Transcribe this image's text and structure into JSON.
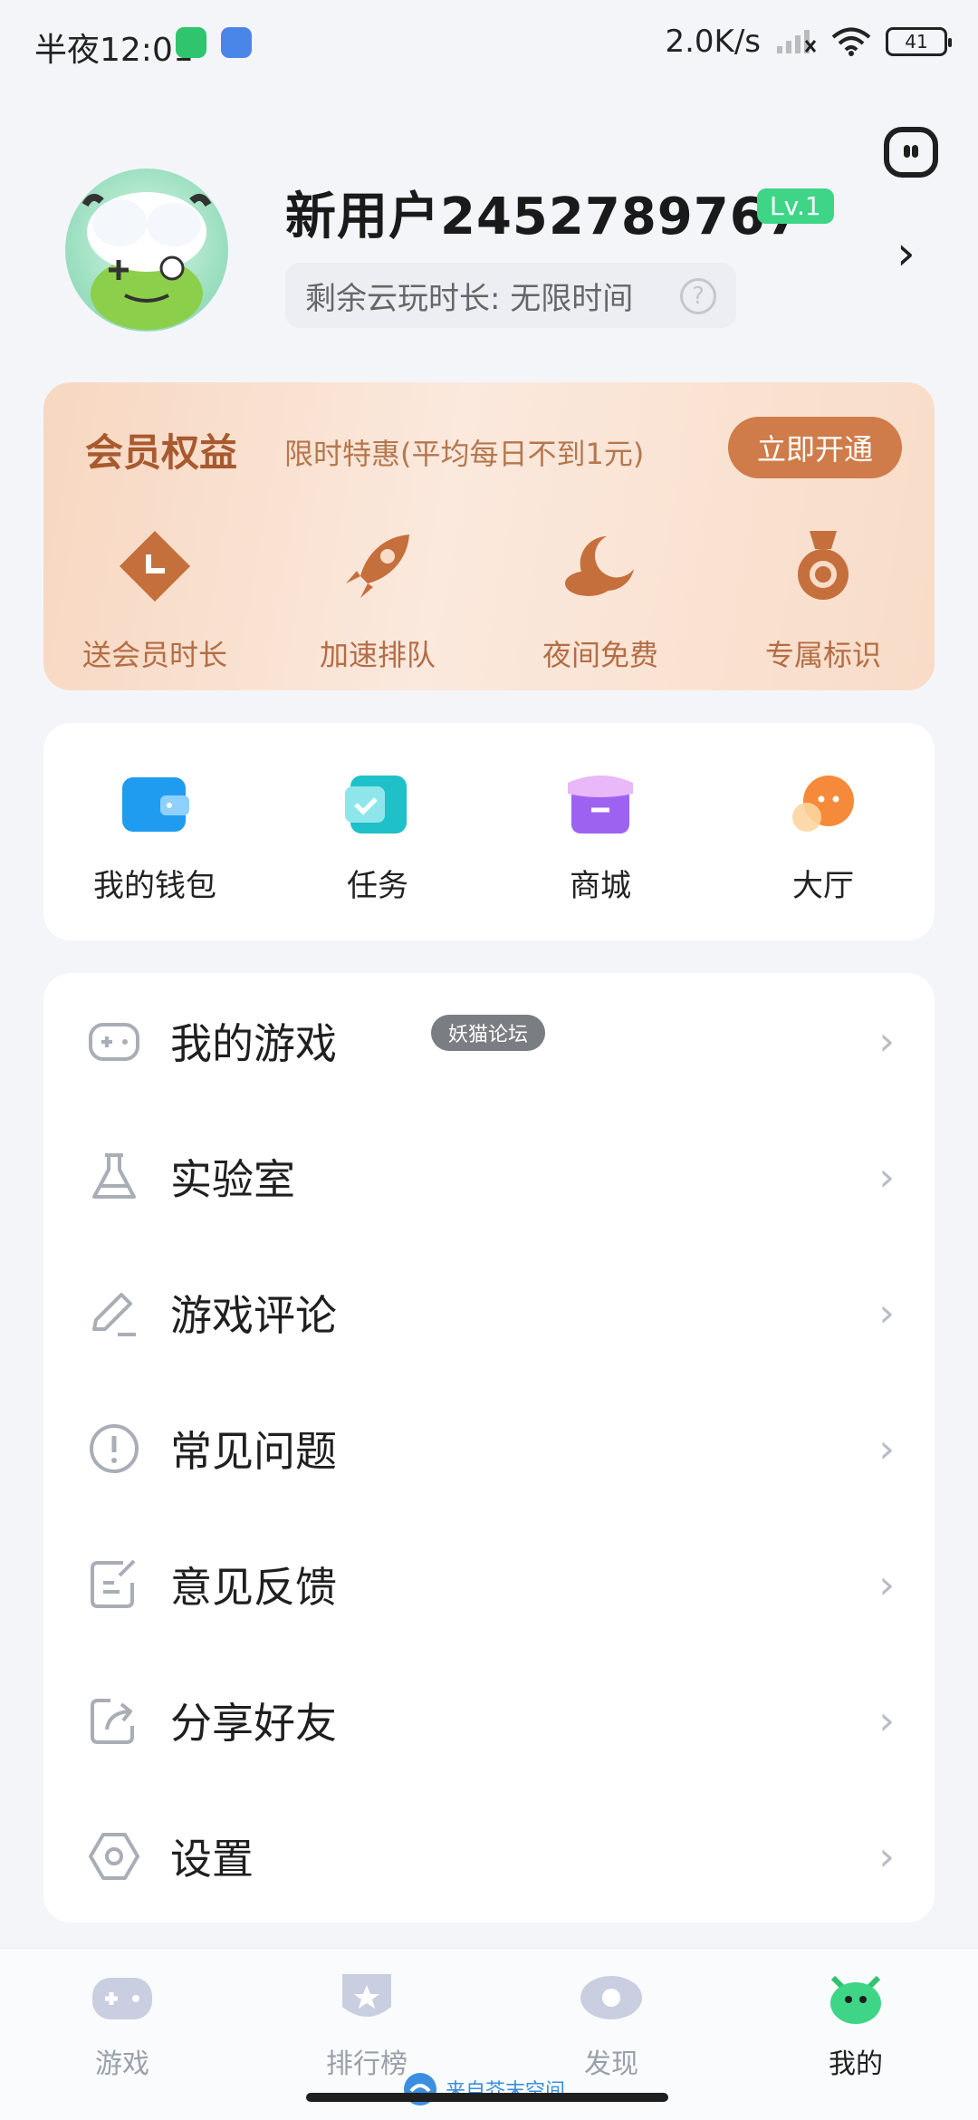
{
  "status_bar": {
    "time": "半夜12:01",
    "speed": "2.0K/s",
    "battery": "41"
  },
  "profile": {
    "username": "新用户2452789767",
    "level": "Lv.1",
    "playtime": "剩余云玩时长: 无限时间"
  },
  "member": {
    "title": "会员权益",
    "subtitle": "限时特惠(平均每日不到1元)",
    "button": "立即开通",
    "perks": [
      {
        "label": "送会员时长",
        "icon": "gift-clock-icon"
      },
      {
        "label": "加速排队",
        "icon": "rocket-icon"
      },
      {
        "label": "夜间免费",
        "icon": "moon-cloud-icon"
      },
      {
        "label": "专属标识",
        "icon": "medal-icon"
      }
    ]
  },
  "quick_actions": [
    {
      "label": "我的钱包",
      "icon": "wallet-icon"
    },
    {
      "label": "任务",
      "icon": "task-icon"
    },
    {
      "label": "商城",
      "icon": "store-icon"
    },
    {
      "label": "大厅",
      "icon": "hall-icon"
    }
  ],
  "menu": [
    {
      "label": "我的游戏",
      "icon": "gamepad-icon"
    },
    {
      "label": "实验室",
      "icon": "flask-icon"
    },
    {
      "label": "游戏评论",
      "icon": "pencil-icon"
    },
    {
      "label": "常见问题",
      "icon": "exclamation-icon"
    },
    {
      "label": "意见反馈",
      "icon": "feedback-icon"
    },
    {
      "label": "分享好友",
      "icon": "share-icon"
    },
    {
      "label": "设置",
      "icon": "settings-icon"
    }
  ],
  "watermark": "妖猫论坛",
  "bottom_nav": [
    {
      "label": "游戏",
      "icon": "gamepad-icon",
      "active": false
    },
    {
      "label": "排行榜",
      "icon": "ranking-icon",
      "active": false
    },
    {
      "label": "发现",
      "icon": "eye-icon",
      "active": false
    },
    {
      "label": "我的",
      "icon": "monster-icon",
      "active": true
    }
  ],
  "source_mark": "来自芥末空间",
  "colors": {
    "accent_green": "#3ed587",
    "member_orange": "#cf7c4a",
    "background": "#f4f5f9"
  }
}
